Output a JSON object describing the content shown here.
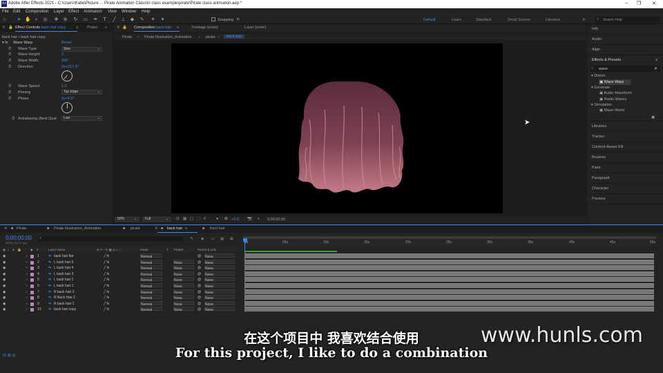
{
  "window": {
    "title": "Adobe After Effects 2021 - C:\\Users\\Katie\\Picture ... Pirate Animation Class\\in class example\\pirate\\Pirate class animation.aep *",
    "app_icon": "Ae"
  },
  "menu": [
    "File",
    "Edit",
    "Composition",
    "Layer",
    "Effect",
    "Animation",
    "View",
    "Window",
    "Help"
  ],
  "toolbar": {
    "snapping_label": "Snapping",
    "workspaces": [
      "Default",
      "Learn",
      "Standard",
      "Small Screen",
      "Libraries"
    ],
    "active_workspace": "Default",
    "search_placeholder": "Search Help"
  },
  "effect_controls": {
    "tab_label": "Effect Controls",
    "tab_target": "back hair copy",
    "other_tab": "Projec",
    "breadcrumb": "back hair • back hair copy",
    "effect_name": "Wave Warp",
    "reset_label": "Reset",
    "props": [
      {
        "label": "Wave Type",
        "value": "Sine",
        "kind": "dropdown"
      },
      {
        "label": "Wave Height",
        "value": "3",
        "kind": "value"
      },
      {
        "label": "Wave Width",
        "value": "200",
        "kind": "value"
      },
      {
        "label": "Direction",
        "value": "0x+217.0°",
        "kind": "value"
      },
      {
        "label": "Wave Speed",
        "value": "1.0",
        "kind": "value"
      },
      {
        "label": "Pinning",
        "value": "Top Edge",
        "kind": "dropdown"
      },
      {
        "label": "Phase",
        "value": "0x+0.0°",
        "kind": "value"
      },
      {
        "label": "Antialiasing (Best Qual",
        "value": "Low",
        "kind": "dropdown"
      }
    ]
  },
  "composition": {
    "tab_label": "Composition",
    "tab_target": "back hair",
    "footage_tab": "Footage (none)",
    "layer_tab": "Layer (none)",
    "breadcrumbs": [
      "Pirate",
      "Pirate Illustration_Animation",
      "pirate",
      "back hair"
    ],
    "zoom": "50%",
    "resolution": "Full",
    "exposure": "+0.0",
    "timecode": "0;00;00;00"
  },
  "right_panel": {
    "top_items": [
      "Info",
      "Audio",
      "Align"
    ],
    "effects_title": "Effects & Presets",
    "search_value": "wave",
    "tree": [
      {
        "group": "Distort",
        "items": [
          "Wave Warp"
        ]
      },
      {
        "group": "Generate",
        "items": [
          "Audio Waveform",
          "Radio Waves"
        ]
      },
      {
        "group": "Simulation",
        "items": [
          "Wave World"
        ]
      }
    ],
    "selected_item": "Wave Warp",
    "bottom_items": [
      "Libraries",
      "Tracker",
      "Content-Aware Fill",
      "Brushes",
      "Paint",
      "Paragraph",
      "Character",
      "Preview"
    ]
  },
  "timeline": {
    "tabs": [
      "Pirate",
      "Pirate Illustration_Animation",
      "pirate",
      "back hair",
      "front hair"
    ],
    "active_tab": "back hair",
    "current_time": "0;00;00;00",
    "fps_note": "00000 (29.97 fps)",
    "columns": {
      "layer_name": "Layer Name",
      "mode": "Mode",
      "t": "T",
      "trkmat": "TrkMat",
      "parent": "Parent & Link"
    },
    "ruler": [
      "0s",
      "05s",
      "10s",
      "15s",
      "20s",
      "25s",
      "30s",
      "35s",
      "40s",
      "45s",
      "50s"
    ],
    "layers": [
      {
        "num": "1",
        "name": "back hair flat",
        "mode": "Normal",
        "trkmat": "",
        "parent": "None",
        "color": "#b48ab4"
      },
      {
        "num": "2",
        "name": "L back hair 5",
        "mode": "Normal",
        "trkmat": "None",
        "parent": "None",
        "color": "#b48ab4"
      },
      {
        "num": "3",
        "name": "L back hair 4",
        "mode": "Normal",
        "trkmat": "None",
        "parent": "None",
        "color": "#b48ab4"
      },
      {
        "num": "4",
        "name": "L back hair 3",
        "mode": "Normal",
        "trkmat": "None",
        "parent": "None",
        "color": "#b48ab4"
      },
      {
        "num": "5",
        "name": "L back hair 2",
        "mode": "Normal",
        "trkmat": "None",
        "parent": "None",
        "color": "#b48ab4"
      },
      {
        "num": "6",
        "name": "L back hair 1",
        "mode": "Normal",
        "trkmat": "None",
        "parent": "None",
        "color": "#b48ab4"
      },
      {
        "num": "7",
        "name": "R back hair 3",
        "mode": "Normal",
        "trkmat": "None",
        "parent": "None",
        "color": "#b48ab4"
      },
      {
        "num": "8",
        "name": "R Back Hair 2",
        "mode": "Normal",
        "trkmat": "None",
        "parent": "None",
        "color": "#b48ab4"
      },
      {
        "num": "9",
        "name": "R back hair 1",
        "mode": "Normal",
        "trkmat": "None",
        "parent": "None",
        "color": "#b48ab4"
      },
      {
        "num": "10",
        "name": "back hair copy",
        "mode": "Normal",
        "trkmat": "None",
        "parent": "None",
        "color": "#b48ab4"
      }
    ]
  },
  "subtitles": {
    "zh": "在这个项目中 我喜欢结合使用",
    "en": "For this project, I like to do a combination"
  },
  "watermark": "www.hunls.com",
  "colors": {
    "accent": "#3d8ae6",
    "panel": "#232323",
    "background": "#1d1d1d",
    "hair": "#8a4a5c"
  }
}
